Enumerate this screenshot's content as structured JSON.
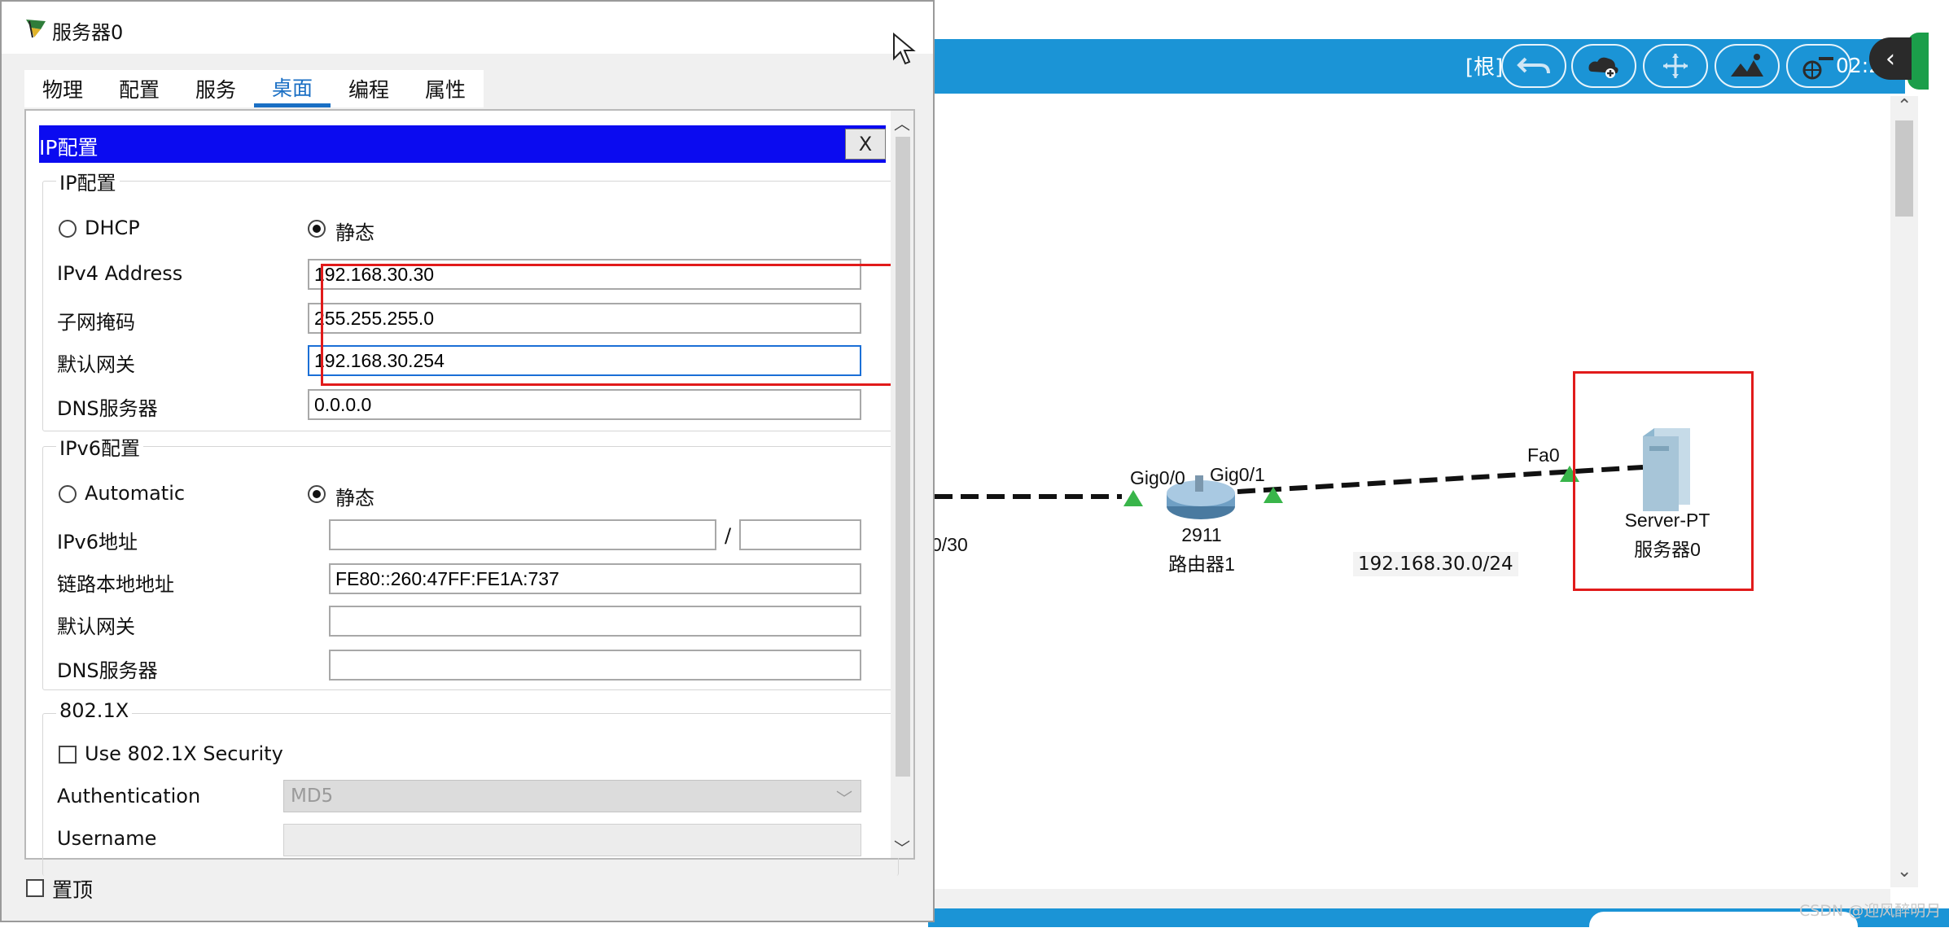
{
  "window": {
    "title": "服务器0"
  },
  "tabs": [
    {
      "label": "物理",
      "active": false
    },
    {
      "label": "配置",
      "active": false
    },
    {
      "label": "服务",
      "active": false
    },
    {
      "label": "桌面",
      "active": true
    },
    {
      "label": "编程",
      "active": false
    },
    {
      "label": "属性",
      "active": false
    }
  ],
  "ip_config": {
    "header_title": "IP配置",
    "close_label": "X",
    "ipv4": {
      "group_title": "IP配置",
      "dhcp_label": "DHCP",
      "static_label": "静态",
      "mode": "static",
      "address_label": "IPv4 Address",
      "address_value": "192.168.30.30",
      "subnet_label": "子网掩码",
      "subnet_value": "255.255.255.0",
      "gateway_label": "默认网关",
      "gateway_value": "192.168.30.254",
      "dns_label": "DNS服务器",
      "dns_value": "0.0.0.0"
    },
    "ipv6": {
      "group_title": "IPv6配置",
      "auto_label": "Automatic",
      "static_label": "静态",
      "mode": "static",
      "address_label": "IPv6地址",
      "address_value": "",
      "prefix_separator": "/",
      "prefix_value": "",
      "link_local_label": "链路本地地址",
      "link_local_value": "FE80::260:47FF:FE1A:737",
      "gateway_label": "默认网关",
      "gateway_value": "",
      "dns_label": "DNS服务器",
      "dns_value": ""
    },
    "dot1x": {
      "group_title": "802.1X",
      "use_security_label": "Use 802.1X Security",
      "use_security_checked": false,
      "authentication_label": "Authentication",
      "authentication_value": "MD5",
      "username_label": "Username"
    }
  },
  "pin_on_top": {
    "label": "置顶",
    "checked": false
  },
  "toolbar": {
    "root_label": "[根]",
    "time": "02:2",
    "collapse_glyph": "‹"
  },
  "topology": {
    "left_subnet_fragment": "0/30",
    "router": {
      "model": "2911",
      "name": "路由器1",
      "port_left": "Gig0/0",
      "port_right": "Gig0/1"
    },
    "subnet_label": "192.168.30.0/24",
    "server": {
      "model": "Server-PT",
      "name": "服务器0",
      "port": "Fa0"
    }
  },
  "colors": {
    "accent_blue": "#1a6fc4",
    "ip_header_blue": "#0b0bf0",
    "toolbar_blue": "#1b94d6",
    "highlight_red": "#e11b1b",
    "link_green": "#39b54a"
  },
  "watermark": "CSDN @迎风醉明月"
}
